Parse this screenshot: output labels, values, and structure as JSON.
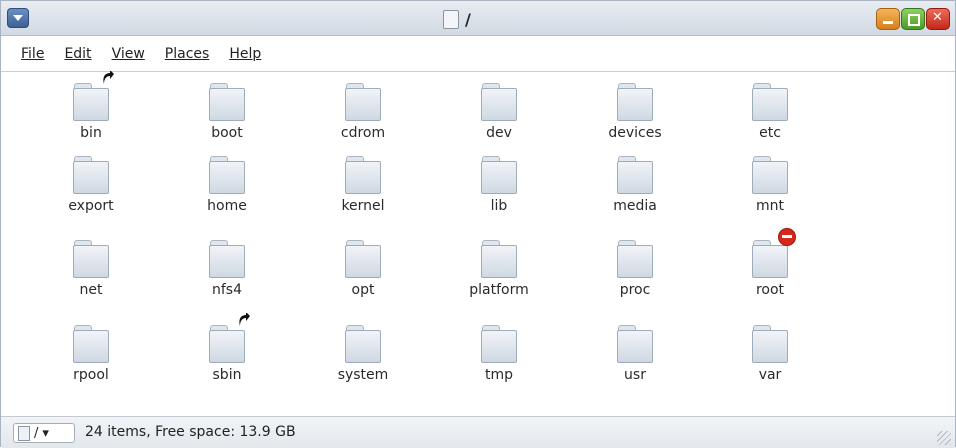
{
  "window": {
    "title": "/"
  },
  "menubar": {
    "items": [
      {
        "label": "File"
      },
      {
        "label": "Edit"
      },
      {
        "label": "View"
      },
      {
        "label": "Places"
      },
      {
        "label": "Help"
      }
    ]
  },
  "files": [
    {
      "label": "bin",
      "emblem": "symlink-arrow-icon"
    },
    {
      "label": "boot"
    },
    {
      "label": "cdrom"
    },
    {
      "label": "dev"
    },
    {
      "label": "devices"
    },
    {
      "label": "etc"
    },
    {
      "label": "export"
    },
    {
      "label": "home"
    },
    {
      "label": "kernel"
    },
    {
      "label": "lib"
    },
    {
      "label": "media"
    },
    {
      "label": "mnt"
    },
    {
      "label": "net"
    },
    {
      "label": "nfs4"
    },
    {
      "label": "opt"
    },
    {
      "label": "platform"
    },
    {
      "label": "proc"
    },
    {
      "label": "root",
      "emblem": "no-access-icon"
    },
    {
      "label": "rpool"
    },
    {
      "label": "sbin",
      "emblem": "symlink-arrow-icon"
    },
    {
      "label": "system"
    },
    {
      "label": "tmp"
    },
    {
      "label": "usr"
    },
    {
      "label": "var"
    }
  ],
  "statusbar": {
    "location": "/",
    "text": "24 items, Free space: 13.9 GB"
  }
}
